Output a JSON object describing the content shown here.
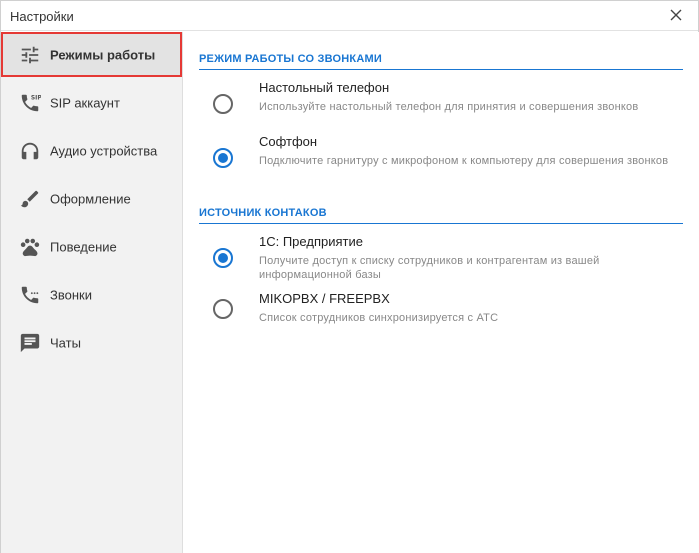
{
  "window": {
    "title": "Настройки"
  },
  "sidebar": {
    "items": [
      {
        "label": "Режимы работы",
        "icon": "sliders-icon",
        "active": true
      },
      {
        "label": "SIP аккаунт",
        "icon": "sip-phone-icon",
        "active": false
      },
      {
        "label": "Аудио устройства",
        "icon": "headphones-icon",
        "active": false
      },
      {
        "label": "Оформление",
        "icon": "brush-icon",
        "active": false
      },
      {
        "label": "Поведение",
        "icon": "paw-icon",
        "active": false
      },
      {
        "label": "Звонки",
        "icon": "phone-icon",
        "active": false
      },
      {
        "label": "Чаты",
        "icon": "chat-icon",
        "active": false
      }
    ]
  },
  "main": {
    "call_mode": {
      "title": "РЕЖИМ РАБОТЫ СО ЗВОНКАМИ",
      "options": [
        {
          "title": "Настольный телефон",
          "desc": "Используйте настольный телефон для принятия и совершения звонков",
          "checked": false
        },
        {
          "title": "Софтфон",
          "desc": "Подключите гарнитуру с микрофоном к компьютеру для совершения звонков",
          "checked": true
        }
      ]
    },
    "contacts_source": {
      "title": "ИСТОЧНИК КОНТАКОВ",
      "options": [
        {
          "title": "1С: Предприятие",
          "desc": "Получите доступ к списку сотрудников и контрагентам из вашей информационной базы",
          "checked": true
        },
        {
          "title": "MIKOPBX / FREEPBX",
          "desc": "Список сотрудников синхронизируется с АТС",
          "checked": false
        }
      ]
    }
  },
  "colors": {
    "accent": "#1976d2",
    "active_outline": "#e53935",
    "sidebar_bg": "#f2f2f2",
    "icon": "#555555"
  }
}
